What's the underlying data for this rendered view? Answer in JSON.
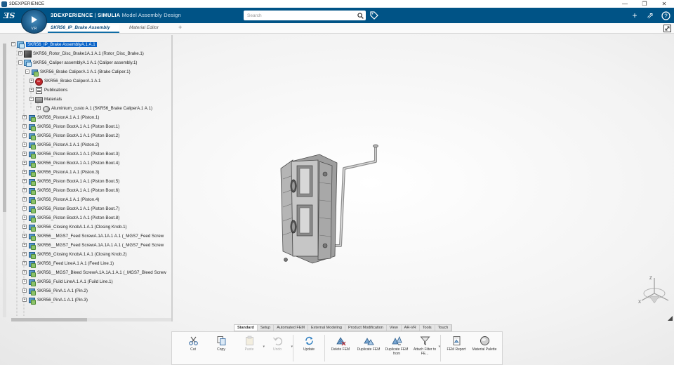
{
  "os_window": {
    "title": "3DEXPERIENCE",
    "minimize": "—",
    "restore": "❐",
    "close": "✕"
  },
  "header": {
    "brand_bold": "3DEXPERIENCE",
    "brand_sep": " | ",
    "brand_product": "SIMULIA",
    "brand_app": " Model Assembly Design",
    "compass_version": "V.R",
    "search_placeholder": "Search",
    "add_label": "+",
    "share_label": "⇗",
    "help_label": "?"
  },
  "tabs": [
    {
      "label": "SKR56_IP_Brake Assembly",
      "active": true
    },
    {
      "label": "Material Editor",
      "active": false
    }
  ],
  "tab_add": "+",
  "tree": {
    "items": [
      {
        "label": "SKR56_IP_Brake AssemblyA.1 A.1",
        "selected": true,
        "icon": "assembly-icon",
        "pm": "−"
      },
      {
        "label": "SKR56_Rotor_Disc_Brake1A.1 A.1 (Rotor_Disc_Brake.1)",
        "selected": false,
        "icon": "rotor-icon",
        "pm": "+"
      },
      {
        "label": "SKR56_Caliper assemblyA.1 A.1 (Caliper assembly.1)",
        "selected": false,
        "icon": "assembly-icon",
        "pm": "−"
      },
      {
        "label": "SKR56_Brake CaliperA.1 A.1 (Brake Caliper.1)",
        "selected": false,
        "icon": "part-icon",
        "pm": "−"
      },
      {
        "label": "SKR56_Brake CaliperA.1 A.1",
        "selected": false,
        "icon": "caliper-icon",
        "pm": "+"
      },
      {
        "label": "Publications",
        "selected": false,
        "icon": "publications-icon",
        "pm": "+"
      },
      {
        "label": "Materials",
        "selected": false,
        "icon": "materials-icon",
        "pm": "−"
      },
      {
        "label": "Aluminium_custo A.1 (SKR56_Brake CaliperA.1 A.1)",
        "selected": false,
        "icon": "material-item-icon",
        "pm": "+"
      },
      {
        "label": "SKR56_PistonA.1 A.1 (Piston.1)",
        "selected": false,
        "icon": "part-icon",
        "pm": "+"
      },
      {
        "label": "SKR56_Piston BootA.1 A.1 (Piston Boot.1)",
        "selected": false,
        "icon": "part-icon",
        "pm": "+"
      },
      {
        "label": "SKR56_Piston BootA.1 A.1 (Piston Boot.2)",
        "selected": false,
        "icon": "part-icon",
        "pm": "+"
      },
      {
        "label": "SKR56_PistonA.1 A.1 (Piston.2)",
        "selected": false,
        "icon": "part-icon",
        "pm": "+"
      },
      {
        "label": "SKR56_Piston BootA.1 A.1 (Piston Boot.3)",
        "selected": false,
        "icon": "part-icon",
        "pm": "+"
      },
      {
        "label": "SKR56_Piston BootA.1 A.1 (Piston Boot.4)",
        "selected": false,
        "icon": "part-icon",
        "pm": "+"
      },
      {
        "label": "SKR56_PistonA.1 A.1 (Piston.3)",
        "selected": false,
        "icon": "part-icon",
        "pm": "+"
      },
      {
        "label": "SKR56_Piston BootA.1 A.1 (Piston Boot.5)",
        "selected": false,
        "icon": "part-icon",
        "pm": "+"
      },
      {
        "label": "SKR56_Piston BootA.1 A.1 (Piston Boot.6)",
        "selected": false,
        "icon": "part-icon",
        "pm": "+"
      },
      {
        "label": "SKR56_PistonA.1 A.1 (Piston.4)",
        "selected": false,
        "icon": "part-icon",
        "pm": "+"
      },
      {
        "label": "SKR56_Piston BootA.1 A.1 (Piston Boot.7)",
        "selected": false,
        "icon": "part-icon",
        "pm": "+"
      },
      {
        "label": "SKR56_Piston BootA.1 A.1 (Piston Boot.8)",
        "selected": false,
        "icon": "part-icon",
        "pm": "+"
      },
      {
        "label": "SKR56_Closing KnobA.1 A.1 (Closing Knob.1)",
        "selected": false,
        "icon": "part-icon",
        "pm": "+"
      },
      {
        "label": "SKR56__MGS7_Feed ScrewA.1A.1A.1 A.1 (_MGS7_Feed Screw",
        "selected": false,
        "icon": "part-icon",
        "pm": "+"
      },
      {
        "label": "SKR56__MGS7_Feed ScrewA.1A.1A.1 A.1 (_MGS7_Feed Screw",
        "selected": false,
        "icon": "part-icon",
        "pm": "+"
      },
      {
        "label": "SKR56_Closing KnobA.1 A.1 (Closing Knob.2)",
        "selected": false,
        "icon": "part-icon",
        "pm": "+"
      },
      {
        "label": "SKR56_Feed LineA.1 A.1 (Feed Line.1)",
        "selected": false,
        "icon": "part-icon",
        "pm": "+"
      },
      {
        "label": "SKR56__MGS7_Bleed ScrewA.1A.1A.1 A.1 (_MGS7_Bleed Screw",
        "selected": false,
        "icon": "part-icon",
        "pm": "+"
      },
      {
        "label": "SKR56_Fuild LineA.1 A.1 (Fuild Line.1)",
        "selected": false,
        "icon": "part-icon",
        "pm": "+"
      },
      {
        "label": "SKR56_PinA.1 A.1 (Pin.2)",
        "selected": false,
        "icon": "part-icon",
        "pm": "+"
      },
      {
        "label": "SKR56_PinA.1 A.1 (Pin.3)",
        "selected": false,
        "icon": "part-icon",
        "pm": "+"
      }
    ]
  },
  "section_tabs": [
    {
      "label": "Standard",
      "active": true
    },
    {
      "label": "Setup",
      "active": false
    },
    {
      "label": "Automated FEM",
      "active": false
    },
    {
      "label": "External Modeling",
      "active": false
    },
    {
      "label": "Product Modification",
      "active": false
    },
    {
      "label": "View",
      "active": false
    },
    {
      "label": "AR-VR",
      "active": false
    },
    {
      "label": "Tools",
      "active": false
    },
    {
      "label": "Touch",
      "active": false
    }
  ],
  "actions": [
    {
      "label": "Cut",
      "icon": "scissors-icon",
      "disabled": false,
      "caret": false
    },
    {
      "label": "Copy",
      "icon": "copy-icon",
      "disabled": false,
      "caret": false
    },
    {
      "label": "Paste",
      "icon": "paste-icon",
      "disabled": true,
      "caret": true
    },
    {
      "label": "Undo",
      "icon": "undo-icon",
      "disabled": true,
      "caret": true
    },
    {
      "label": "Update",
      "icon": "update-icon",
      "disabled": false,
      "caret": false
    },
    {
      "label": "Delete FEM",
      "icon": "delete-fem-icon",
      "disabled": false,
      "caret": false
    },
    {
      "label": "Duplicate FEM",
      "icon": "duplicate-fem-icon",
      "disabled": false,
      "caret": false
    },
    {
      "label": "Duplicate FEM from",
      "icon": "duplicate-fem-from-icon",
      "disabled": false,
      "caret": false
    },
    {
      "label": "Attach Filter to FE...",
      "icon": "filter-icon",
      "disabled": false,
      "caret": true
    },
    {
      "label": "FEM Report",
      "icon": "report-icon",
      "disabled": false,
      "caret": false
    },
    {
      "label": "Material Palette",
      "icon": "palette-icon",
      "disabled": false,
      "caret": false
    }
  ],
  "triad_labels": {
    "x": "X",
    "z": "Z"
  },
  "colors": {
    "header_bg": "#005386",
    "selection": "#0a64c8",
    "active_tab_underline": "#0f6ca5"
  }
}
